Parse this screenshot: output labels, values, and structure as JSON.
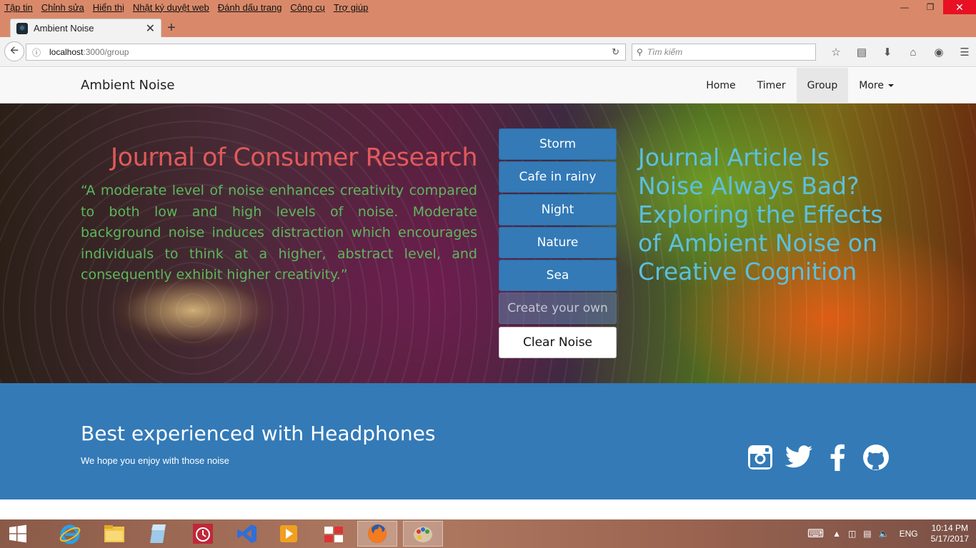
{
  "browser": {
    "menu": [
      "Tập tin",
      "Chỉnh sửa",
      "Hiển thị",
      "Nhật ký duyệt web",
      "Đánh dấu trang",
      "Công cụ",
      "Trợ giúp"
    ],
    "tab_title": "Ambient Noise",
    "url_host": "localhost",
    "url_path": ":3000/group",
    "search_placeholder": "Tìm kiếm"
  },
  "site": {
    "brand": "Ambient Noise",
    "nav": [
      {
        "label": "Home",
        "active": false
      },
      {
        "label": "Timer",
        "active": false
      },
      {
        "label": "Group",
        "active": true
      },
      {
        "label": "More",
        "active": false
      }
    ]
  },
  "hero": {
    "journal_title": "Journal of Consumer Research",
    "quote": "“A moderate level of noise enhances creativity compared to both low and high levels of noise. Moderate background noise induces distraction which encourages individuals to think at a higher, abstract level, and consequently exhibit higher creativity.”",
    "noises": [
      "Storm",
      "Cafe in rainy",
      "Night",
      "Nature",
      "Sea"
    ],
    "create_label": "Create your own",
    "clear_label": "Clear Noise",
    "article_title": "Journal Article Is Noise Always Bad? Exploring the Effects of Ambient Noise on Creative Cognition"
  },
  "footer": {
    "heading": "Best experienced with Headphones",
    "subtext": "We hope you enjoy with those noise",
    "socials": [
      "instagram-icon",
      "twitter-icon",
      "facebook-icon",
      "github-icon"
    ]
  },
  "taskbar": {
    "lang": "ENG",
    "time": "10:14 PM",
    "date": "5/17/2017"
  },
  "colors": {
    "primary": "#337ab7",
    "journal_title": "#e05a5a",
    "quote": "#5cb85c",
    "article": "#5bc0de",
    "titlebar": "#d9896a"
  }
}
